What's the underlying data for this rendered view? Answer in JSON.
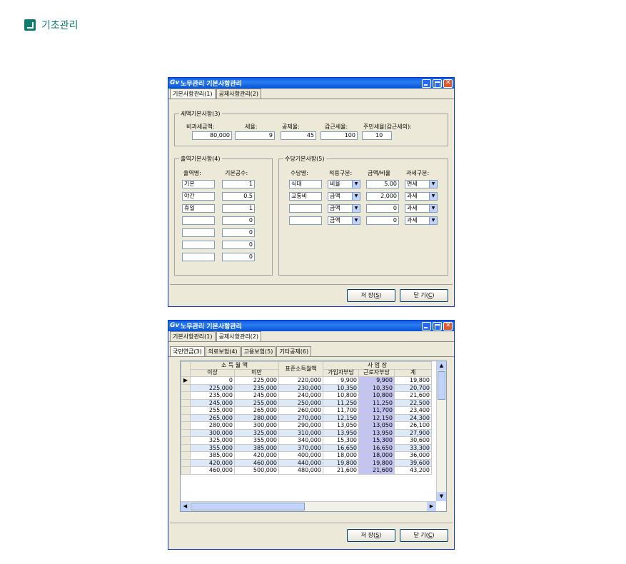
{
  "page_title": "기초관리",
  "window1": {
    "title": "노무관리 기본사항관리",
    "tabs": [
      "기본사항관리(1)",
      "공제사항관리(2)"
    ],
    "tax_group": {
      "legend": "세액기본사항(3)",
      "fields": [
        {
          "label": "비과세금액:",
          "value": "80,000"
        },
        {
          "label": "세율:",
          "value": "9"
        },
        {
          "label": "공제율:",
          "value": "45"
        },
        {
          "label": "갑근세율:",
          "value": "100"
        },
        {
          "label": "주민세율(갑근세의):",
          "value": "10"
        }
      ]
    },
    "work_group": {
      "legend": "출역기본사항(4)",
      "col_name": "출역명:",
      "col_count": "기본공수:",
      "rows": [
        {
          "name": "기본",
          "count": "1"
        },
        {
          "name": "야간",
          "count": "0.5"
        },
        {
          "name": "휴일",
          "count": "1"
        },
        {
          "name": "",
          "count": "0"
        },
        {
          "name": "",
          "count": "0"
        },
        {
          "name": "",
          "count": "0"
        },
        {
          "name": "",
          "count": "0"
        }
      ]
    },
    "allowance_group": {
      "legend": "수당기본사항(5)",
      "headers": [
        "수당명:",
        "적용구분:",
        "금액/비율",
        "과세구분:"
      ],
      "rows": [
        {
          "name": "식대",
          "type": "비율",
          "amount": "5.00",
          "tax": "면세"
        },
        {
          "name": "교통비",
          "type": "금액",
          "amount": "2,000",
          "tax": "과세"
        },
        {
          "name": "",
          "type": "금액",
          "amount": "0",
          "tax": "과세"
        },
        {
          "name": "",
          "type": "금액",
          "amount": "0",
          "tax": "과세"
        }
      ]
    },
    "save_label": "저 장(",
    "save_key": "S",
    "close_label": "닫 기(",
    "close_key": "C"
  },
  "window2": {
    "title": "노무관리 기본사항관리",
    "tabs": [
      "기본사항관리(1)",
      "공제사항관리(2)"
    ],
    "subtabs": [
      "국민연금(3)",
      "의료보험(4)",
      "고용보험(5)",
      "기타공제(6)"
    ],
    "header": {
      "income": "소 득 월 액",
      "over": "이상",
      "under": "미만",
      "standard": "표준소득월액",
      "business": "사 업 장",
      "subscriber": "가입자부담",
      "worker": "근로자부담",
      "total": "계"
    },
    "rows": [
      [
        "0",
        "225,000",
        "220,000",
        "9,900",
        "9,900",
        "19,800"
      ],
      [
        "225,000",
        "235,000",
        "230,000",
        "10,350",
        "10,350",
        "20,700"
      ],
      [
        "235,000",
        "245,000",
        "240,000",
        "10,800",
        "10,800",
        "21,600"
      ],
      [
        "245,000",
        "255,000",
        "250,000",
        "11,250",
        "11,250",
        "22,500"
      ],
      [
        "255,000",
        "265,000",
        "260,000",
        "11,700",
        "11,700",
        "23,400"
      ],
      [
        "265,000",
        "280,000",
        "270,000",
        "12,150",
        "12,150",
        "24,300"
      ],
      [
        "280,000",
        "300,000",
        "290,000",
        "13,050",
        "13,050",
        "26,100"
      ],
      [
        "300,000",
        "325,000",
        "310,000",
        "13,950",
        "13,950",
        "27,900"
      ],
      [
        "325,000",
        "355,000",
        "340,000",
        "15,300",
        "15,300",
        "30,600"
      ],
      [
        "355,000",
        "385,000",
        "370,000",
        "16,650",
        "16,650",
        "33,300"
      ],
      [
        "385,000",
        "420,000",
        "400,000",
        "18,000",
        "18,000",
        "36,000"
      ],
      [
        "420,000",
        "460,000",
        "440,000",
        "19,800",
        "19,800",
        "39,600"
      ],
      [
        "460,000",
        "500,000",
        "480,000",
        "21,600",
        "21,600",
        "43,200"
      ]
    ],
    "save_label": "저 장(",
    "save_key": "S",
    "close_label": "닫 기(",
    "close_key": "C"
  }
}
